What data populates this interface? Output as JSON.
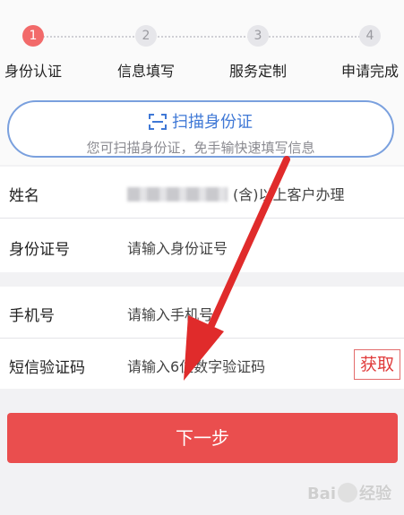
{
  "steps": [
    {
      "num": "1",
      "label": "身份认证"
    },
    {
      "num": "2",
      "label": "信息填写"
    },
    {
      "num": "3",
      "label": "服务定制"
    },
    {
      "num": "4",
      "label": "申请完成"
    }
  ],
  "scan": {
    "icon": "scan-frame-icon",
    "title": "扫描身份证",
    "subtitle": "您可扫描身份证，免手输快速填写信息"
  },
  "form": {
    "name": {
      "label": "姓名",
      "value": "(含)以上客户办理"
    },
    "id_card": {
      "label": "身份证号",
      "placeholder": "请输入身份证号"
    },
    "phone": {
      "label": "手机号",
      "placeholder": "请输入手机号"
    },
    "sms": {
      "label": "短信验证码",
      "placeholder": "请输入6位数字验证码",
      "button": "获取"
    }
  },
  "next_button": "下一步",
  "watermark": {
    "left": "Bai",
    "right": "经验"
  },
  "colors": {
    "accent": "#ea4e4e",
    "scan_blue": "#3f78d6",
    "annotation_arrow": "#e02b2b"
  }
}
